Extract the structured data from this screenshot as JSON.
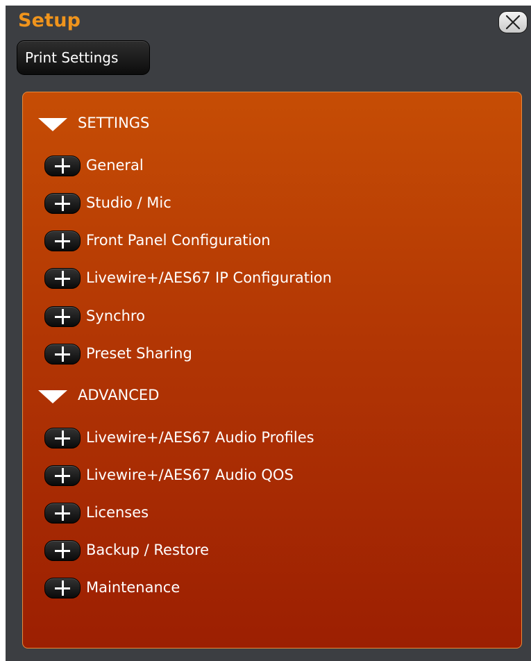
{
  "window": {
    "title": "Setup",
    "title_color": "#f0941c",
    "background": "#3c3e42",
    "close_icon": "close-x-icon"
  },
  "toolbar": {
    "print_settings_label": "Print Settings"
  },
  "panel": {
    "gradient_colors": [
      "#c64d05",
      "#9c1f02"
    ],
    "sections": [
      {
        "label": "SETTINGS",
        "expanded": true,
        "icon": "triangle-down-icon",
        "items": [
          {
            "label": "General",
            "icon": "plus-icon"
          },
          {
            "label": "Studio / Mic",
            "icon": "plus-icon"
          },
          {
            "label": "Front Panel Configuration",
            "icon": "plus-icon"
          },
          {
            "label": "Livewire+/AES67 IP Configuration",
            "icon": "plus-icon"
          },
          {
            "label": "Synchro",
            "icon": "plus-icon"
          },
          {
            "label": "Preset Sharing",
            "icon": "plus-icon"
          }
        ]
      },
      {
        "label": "ADVANCED",
        "expanded": true,
        "icon": "triangle-down-icon",
        "items": [
          {
            "label": "Livewire+/AES67 Audio Profiles",
            "icon": "plus-icon"
          },
          {
            "label": "Livewire+/AES67 Audio QOS",
            "icon": "plus-icon"
          },
          {
            "label": "Licenses",
            "icon": "plus-icon"
          },
          {
            "label": "Backup / Restore",
            "icon": "plus-icon"
          },
          {
            "label": "Maintenance",
            "icon": "plus-icon"
          }
        ]
      }
    ]
  }
}
